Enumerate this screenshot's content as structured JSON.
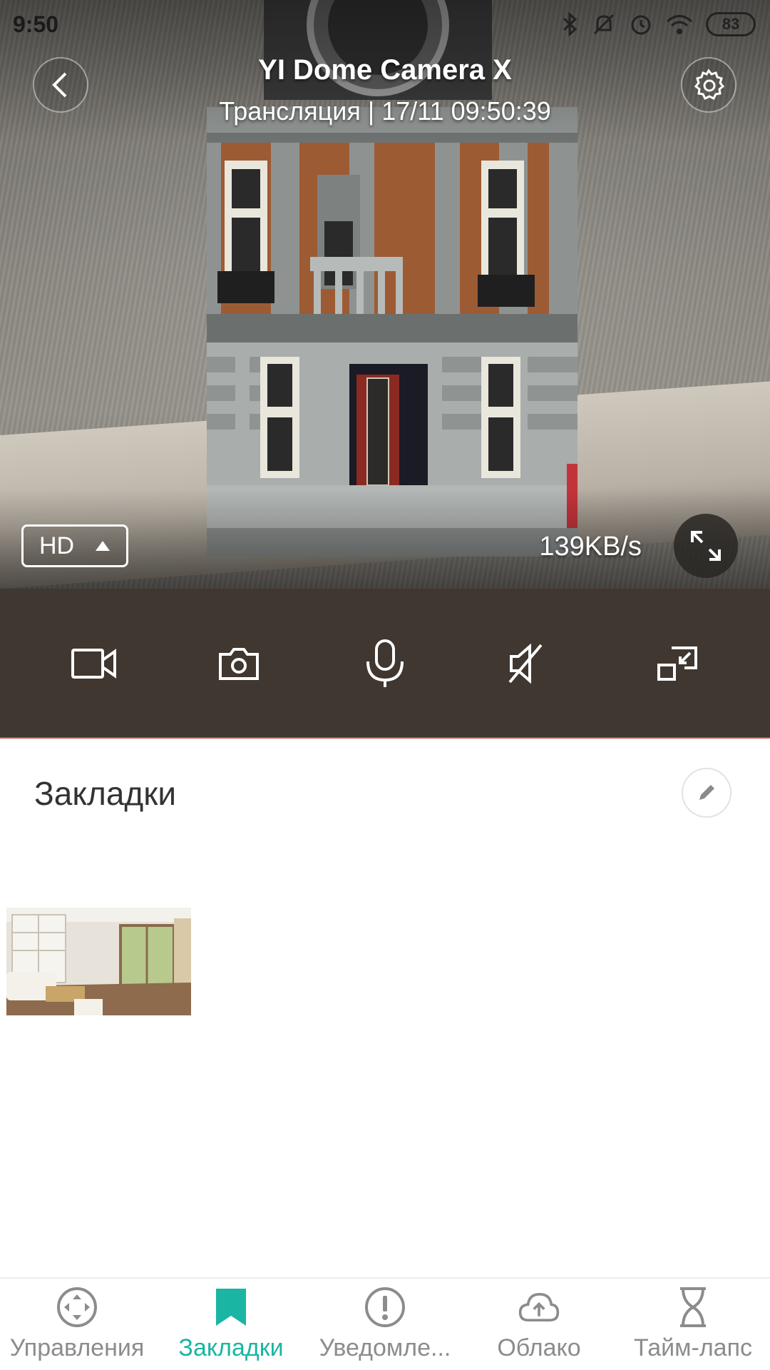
{
  "status_bar": {
    "time": "9:50",
    "battery": "83",
    "icons": [
      "bluetooth-icon",
      "bell-off-icon",
      "alarm-icon",
      "wifi-icon",
      "battery-icon"
    ]
  },
  "header": {
    "title": "YI Dome Camera X",
    "subtitle": "Трансляция | 17/11 09:50:39"
  },
  "video": {
    "quality": "HD",
    "bitrate": "139KB/s"
  },
  "controls": [
    "record-video-icon",
    "snapshot-icon",
    "microphone-icon",
    "mute-icon",
    "picture-in-picture-icon"
  ],
  "bookmarks": {
    "title": "Закладки"
  },
  "nav": {
    "active_color": "#1ab6a3",
    "inactive_color": "#8c8c8c",
    "items": [
      {
        "label": "Управления",
        "icon": "control-icon"
      },
      {
        "label": "Закладки",
        "icon": "bookmark-icon"
      },
      {
        "label": "Уведомле...",
        "icon": "alert-icon"
      },
      {
        "label": "Облако",
        "icon": "cloud-upload-icon"
      },
      {
        "label": "Тайм-лапс",
        "icon": "hourglass-icon"
      }
    ]
  }
}
